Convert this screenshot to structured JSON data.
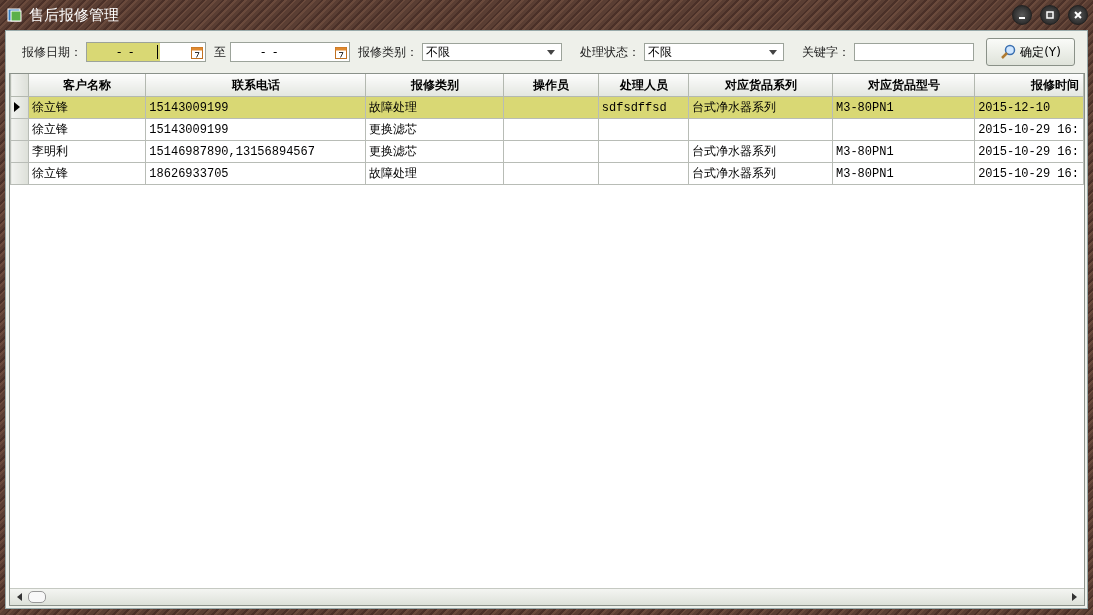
{
  "window": {
    "title": "售后报修管理"
  },
  "filters": [
    {
      "kind": "date",
      "label": "报修日期：",
      "value": "-  -",
      "focused": true
    },
    {
      "kind": "date",
      "label": "至",
      "value": "-  -",
      "focused": false
    },
    {
      "kind": "select",
      "label": "报修类别：",
      "value": "不限"
    },
    {
      "kind": "select",
      "label": "处理状态：",
      "value": "不限"
    },
    {
      "kind": "text",
      "label": "关键字："
    },
    {
      "kind": "button",
      "label": "确定(Y)"
    }
  ],
  "table": {
    "columns": [
      {
        "title": "客户名称"
      },
      {
        "title": "联系电话"
      },
      {
        "title": "报修类别"
      },
      {
        "title": "操作员"
      },
      {
        "title": "处理人员"
      },
      {
        "title": "对应货品系列"
      },
      {
        "title": "对应货品型号"
      },
      {
        "title": "报修时间"
      }
    ],
    "rows": [
      {
        "selected": true,
        "cells": [
          "徐立锋",
          "15143009199",
          "故障处理",
          "",
          "sdfsdffsd",
          "台式净水器系列",
          "M3-80PN1",
          "2015-12-10"
        ]
      },
      {
        "selected": false,
        "cells": [
          "徐立锋",
          "15143009199",
          "更换滤芯",
          "",
          "",
          "",
          "",
          "2015-10-29 16:"
        ]
      },
      {
        "selected": false,
        "cells": [
          "李明利",
          "15146987890,13156894567",
          "更换滤芯",
          "",
          "",
          "台式净水器系列",
          "M3-80PN1",
          "2015-10-29 16:"
        ]
      },
      {
        "selected": false,
        "cells": [
          "徐立锋",
          "18626933705",
          "故障处理",
          "",
          "",
          "台式净水器系列",
          "M3-80PN1",
          "2015-10-29 16:"
        ]
      }
    ]
  }
}
